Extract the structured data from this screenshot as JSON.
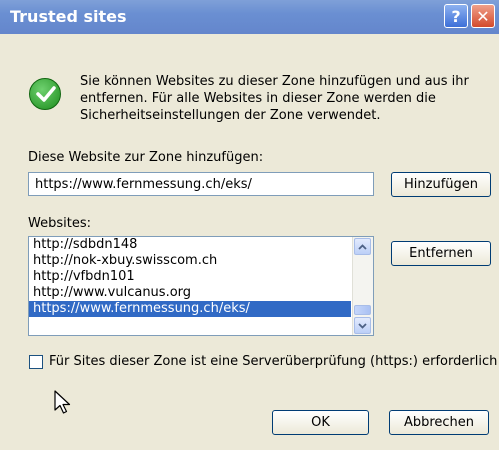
{
  "window": {
    "title": "Trusted sites",
    "help_glyph": "?",
    "close_glyph": "✕"
  },
  "info": {
    "text_line1": "Sie können Websites zu dieser Zone hinzufügen und aus ihr",
    "text_line2": "entfernen. Für alle Websites in dieser Zone werden die",
    "text_line3": "Sicherheitseinstellungen der Zone verwendet."
  },
  "add_section": {
    "label": "Diese Website zur Zone hinzufügen:",
    "input_value": "https://www.fernmessung.ch/eks/",
    "add_button": "Hinzufügen"
  },
  "websites": {
    "label": "Websites:",
    "items": [
      "http://sdbdn148",
      "http://nok-xbuy.swisscom.ch",
      "http://vfbdn101",
      "http://www.vulcanus.org",
      "https://www.fernmessung.ch/eks/"
    ],
    "selected_index": 4,
    "remove_button": "Entfernen"
  },
  "https_check": {
    "label": "Für Sites dieser Zone ist eine Serverüberprüfung (https:) erforderlich",
    "checked": false
  },
  "footer": {
    "ok_button": "OK",
    "cancel_button": "Abbrechen"
  },
  "icons": {
    "info_icon": "check-circle-icon",
    "cursor": "mouse-pointer-icon"
  },
  "colors": {
    "titlebar": "#6a8fd2",
    "selection": "#316ac5",
    "dialog_bg": "#ece9d8"
  }
}
